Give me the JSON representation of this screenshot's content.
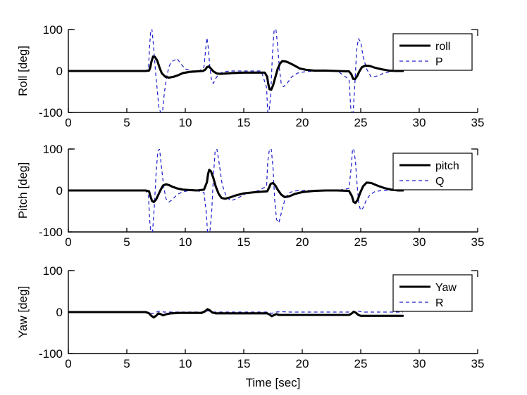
{
  "figure": {
    "background": "#ffffff",
    "solid_color": "#000000",
    "dashed_color": "#2222cc"
  },
  "chart_data": [
    {
      "type": "line",
      "title": "",
      "xlabel": "",
      "ylabel": "Roll [deg]",
      "xlim": [
        0,
        35
      ],
      "ylim": [
        -100,
        100
      ],
      "xticks": [
        0,
        5,
        10,
        15,
        20,
        25,
        30,
        35
      ],
      "yticks": [
        -100,
        0,
        100
      ],
      "grid": false,
      "legend_position": "upper right",
      "series": [
        {
          "name": "roll",
          "style": "solid",
          "color": "#000000",
          "x": [
            0,
            1,
            2,
            3,
            4,
            5,
            6,
            6.6,
            6.9,
            7.0,
            7.1,
            7.25,
            7.4,
            7.6,
            7.8,
            8.0,
            8.3,
            8.6,
            9.0,
            9.4,
            9.8,
            10.4,
            11.0,
            11.5,
            11.7,
            11.85,
            12.0,
            12.15,
            12.4,
            12.7,
            13.0,
            13.5,
            14.0,
            15.0,
            16.0,
            16.8,
            17.0,
            17.1,
            17.2,
            17.35,
            17.5,
            17.7,
            17.9,
            18.1,
            18.3,
            18.6,
            19.0,
            19.4,
            19.8,
            20.3,
            21.0,
            22.0,
            23.0,
            24.0,
            24.2,
            24.35,
            24.5,
            24.7,
            24.9,
            25.1,
            25.4,
            25.8,
            26.2,
            26.8,
            27.4,
            28.0,
            28.6
          ],
          "y": [
            0,
            0,
            0,
            0,
            0,
            0,
            0,
            0,
            1,
            8,
            22,
            35,
            34,
            25,
            8,
            -6,
            -14,
            -16,
            -14,
            -10,
            -5,
            -2,
            -1,
            0,
            3,
            9,
            11,
            7,
            -1,
            -6,
            -7,
            -6,
            -5,
            -4,
            -4,
            -4,
            -14,
            -32,
            -44,
            -45,
            -35,
            -15,
            5,
            18,
            24,
            23,
            18,
            12,
            6,
            3,
            1,
            1,
            0,
            -1,
            -8,
            -19,
            -20,
            -12,
            0,
            9,
            13,
            12,
            8,
            4,
            1,
            0,
            0
          ]
        },
        {
          "name": "P",
          "style": "dashed",
          "color": "#2222cc",
          "x": [
            0,
            1,
            2,
            3,
            4,
            5,
            6,
            6.6,
            6.85,
            6.95,
            7.05,
            7.15,
            7.3,
            7.45,
            7.6,
            7.75,
            7.9,
            8.05,
            8.2,
            8.4,
            8.6,
            8.8,
            9.0,
            9.3,
            9.6,
            10.0,
            10.6,
            11.2,
            11.6,
            11.75,
            11.85,
            11.95,
            12.1,
            12.25,
            12.4,
            12.6,
            12.9,
            13.3,
            13.8,
            14.5,
            15.5,
            16.5,
            16.95,
            17.05,
            17.15,
            17.3,
            17.45,
            17.6,
            17.75,
            17.9,
            18.05,
            18.2,
            18.4,
            18.7,
            19.1,
            19.6,
            20.2,
            21.0,
            22.0,
            23.0,
            24.0,
            24.15,
            24.25,
            24.35,
            24.5,
            24.65,
            24.8,
            25.0,
            25.2,
            25.5,
            25.9,
            26.4,
            27.0,
            27.6,
            28.2,
            28.6
          ],
          "y": [
            0,
            0,
            0,
            0,
            0,
            0,
            0,
            0,
            5,
            60,
            100,
            100,
            55,
            0,
            -45,
            -90,
            -100,
            -100,
            -55,
            -15,
            10,
            22,
            25,
            30,
            18,
            5,
            0,
            0,
            10,
            55,
            80,
            60,
            10,
            -25,
            -30,
            -18,
            -6,
            -2,
            0,
            0,
            0,
            0,
            -40,
            -100,
            -100,
            -60,
            40,
            100,
            100,
            60,
            5,
            -30,
            -38,
            -30,
            -14,
            -5,
            -2,
            0,
            0,
            0,
            -20,
            -90,
            -100,
            -100,
            -30,
            50,
            78,
            70,
            35,
            5,
            -15,
            -12,
            -5,
            -1,
            0,
            0
          ]
        }
      ]
    },
    {
      "type": "line",
      "title": "",
      "xlabel": "",
      "ylabel": "Pitch [deg]",
      "xlim": [
        0,
        35
      ],
      "ylim": [
        -100,
        100
      ],
      "xticks": [
        0,
        5,
        10,
        15,
        20,
        25,
        30,
        35
      ],
      "yticks": [
        -100,
        0,
        100
      ],
      "grid": false,
      "legend_position": "upper right",
      "series": [
        {
          "name": "pitch",
          "style": "solid",
          "color": "#000000",
          "x": [
            0,
            1,
            2,
            3,
            4,
            5,
            6,
            6.6,
            6.9,
            7.0,
            7.15,
            7.3,
            7.5,
            7.7,
            7.9,
            8.1,
            8.35,
            8.6,
            8.9,
            9.3,
            9.8,
            10.4,
            11.0,
            11.6,
            11.85,
            11.95,
            12.05,
            12.2,
            12.4,
            12.6,
            12.85,
            13.1,
            13.4,
            13.8,
            14.3,
            15.0,
            16.0,
            17.0,
            17.15,
            17.3,
            17.5,
            17.7,
            17.9,
            18.2,
            18.5,
            18.9,
            19.4,
            20.0,
            21.0,
            22.0,
            23.0,
            24.0,
            24.25,
            24.4,
            24.55,
            24.75,
            24.95,
            25.2,
            25.5,
            25.9,
            26.4,
            27.0,
            27.6,
            28.2,
            28.6
          ],
          "y": [
            0,
            0,
            0,
            0,
            0,
            0,
            0,
            0,
            -2,
            -12,
            -25,
            -28,
            -22,
            -10,
            2,
            12,
            15,
            13,
            9,
            5,
            2,
            1,
            0,
            2,
            20,
            40,
            50,
            46,
            30,
            10,
            -8,
            -18,
            -20,
            -17,
            -12,
            -7,
            -4,
            -2,
            6,
            16,
            18,
            12,
            2,
            -10,
            -16,
            -14,
            -8,
            -4,
            -1,
            0,
            0,
            -1,
            -14,
            -28,
            -30,
            -22,
            -6,
            10,
            19,
            18,
            12,
            6,
            2,
            0,
            0
          ]
        },
        {
          "name": "Q",
          "style": "dashed",
          "color": "#2222cc",
          "x": [
            0,
            1,
            2,
            3,
            4,
            5,
            6,
            6.6,
            6.85,
            6.95,
            7.05,
            7.2,
            7.35,
            7.5,
            7.65,
            7.8,
            7.95,
            8.15,
            8.35,
            8.6,
            8.9,
            9.3,
            9.8,
            10.4,
            11.0,
            11.6,
            11.8,
            11.9,
            12.0,
            12.1,
            12.25,
            12.4,
            12.55,
            12.7,
            12.9,
            13.15,
            13.5,
            13.9,
            14.5,
            15.3,
            16.2,
            16.95,
            17.05,
            17.2,
            17.35,
            17.5,
            17.65,
            17.8,
            18.0,
            18.25,
            18.55,
            18.9,
            19.4,
            20.0,
            21.0,
            22.0,
            23.0,
            24.0,
            24.2,
            24.3,
            24.4,
            24.55,
            24.7,
            24.85,
            25.0,
            25.2,
            25.45,
            25.8,
            26.2,
            26.8,
            27.4,
            28.0,
            28.6
          ],
          "y": [
            0,
            0,
            0,
            0,
            0,
            0,
            0,
            0,
            -10,
            -70,
            -100,
            -100,
            -40,
            40,
            95,
            100,
            60,
            10,
            -20,
            -28,
            -22,
            -10,
            -3,
            0,
            0,
            -5,
            -55,
            -100,
            -100,
            -100,
            -55,
            30,
            95,
            100,
            65,
            15,
            -15,
            -25,
            -18,
            -6,
            -1,
            10,
            70,
            100,
            100,
            55,
            -25,
            -70,
            -78,
            -50,
            -18,
            -5,
            -1,
            0,
            0,
            0,
            0,
            5,
            60,
            100,
            100,
            70,
            10,
            -35,
            -48,
            -42,
            -25,
            -10,
            -3,
            0,
            0,
            0,
            0
          ]
        }
      ]
    },
    {
      "type": "line",
      "title": "",
      "xlabel": "Time [sec]",
      "ylabel": "Yaw [deg]",
      "xlim": [
        0,
        35
      ],
      "ylim": [
        -100,
        100
      ],
      "xticks": [
        0,
        5,
        10,
        15,
        20,
        25,
        30,
        35
      ],
      "yticks": [
        -100,
        0,
        100
      ],
      "grid": false,
      "legend_position": "upper right",
      "series": [
        {
          "name": "Yaw",
          "style": "solid",
          "color": "#000000",
          "x": [
            0,
            1,
            2,
            3,
            4,
            5,
            6,
            6.6,
            6.9,
            7.1,
            7.3,
            7.5,
            7.7,
            7.9,
            8.1,
            8.4,
            8.8,
            9.5,
            10.5,
            11.4,
            11.7,
            11.9,
            12.1,
            12.3,
            12.6,
            13.0,
            14.0,
            15.0,
            16.0,
            17.0,
            17.2,
            17.4,
            17.6,
            17.8,
            18.0,
            18.4,
            19.0,
            20.0,
            21.0,
            22.0,
            23.0,
            24.0,
            24.2,
            24.4,
            24.6,
            24.8,
            25.0,
            25.4,
            26.0,
            27.0,
            28.0,
            28.6
          ],
          "y": [
            0,
            0,
            0,
            0,
            0,
            0,
            0,
            0,
            -3,
            -9,
            -13,
            -9,
            -3,
            -5,
            -8,
            -5,
            -3,
            -2,
            -2,
            -2,
            2,
            7,
            4,
            -1,
            -3,
            -3,
            -3,
            -3,
            -3,
            -3,
            -6,
            -10,
            -7,
            -5,
            -7,
            -7,
            -7,
            -7,
            -7,
            -7,
            -7,
            -7,
            -4,
            1,
            -2,
            -7,
            -9,
            -9,
            -9,
            -9,
            -9,
            -9
          ]
        },
        {
          "name": "R",
          "style": "dashed",
          "color": "#2222cc",
          "x": [
            0,
            2,
            4,
            6,
            6.8,
            7.0,
            7.2,
            7.5,
            7.8,
            8.2,
            9.0,
            10.0,
            11.0,
            11.7,
            11.9,
            12.1,
            12.4,
            13.0,
            14.0,
            15.0,
            16.0,
            17.0,
            17.2,
            17.4,
            17.7,
            18.2,
            19.0,
            20.0,
            21.0,
            22.0,
            23.0,
            24.0,
            24.3,
            24.5,
            24.8,
            25.2,
            26.0,
            27.0,
            28.0,
            28.6
          ],
          "y": [
            0,
            0,
            0,
            0,
            0,
            -2,
            -4,
            0,
            2,
            0,
            0,
            0,
            0,
            0,
            3,
            2,
            0,
            0,
            0,
            0,
            0,
            0,
            -2,
            -3,
            0,
            1,
            0,
            0,
            0,
            0,
            0,
            0,
            -2,
            0,
            2,
            0,
            0,
            0,
            0,
            0
          ]
        }
      ]
    }
  ],
  "legends": [
    {
      "entries": [
        {
          "label": "roll",
          "style": "solid"
        },
        {
          "label": "P",
          "style": "dashed"
        }
      ]
    },
    {
      "entries": [
        {
          "label": "pitch",
          "style": "solid"
        },
        {
          "label": "Q",
          "style": "dashed"
        }
      ]
    },
    {
      "entries": [
        {
          "label": "Yaw",
          "style": "solid"
        },
        {
          "label": "R",
          "style": "dashed"
        }
      ]
    }
  ]
}
